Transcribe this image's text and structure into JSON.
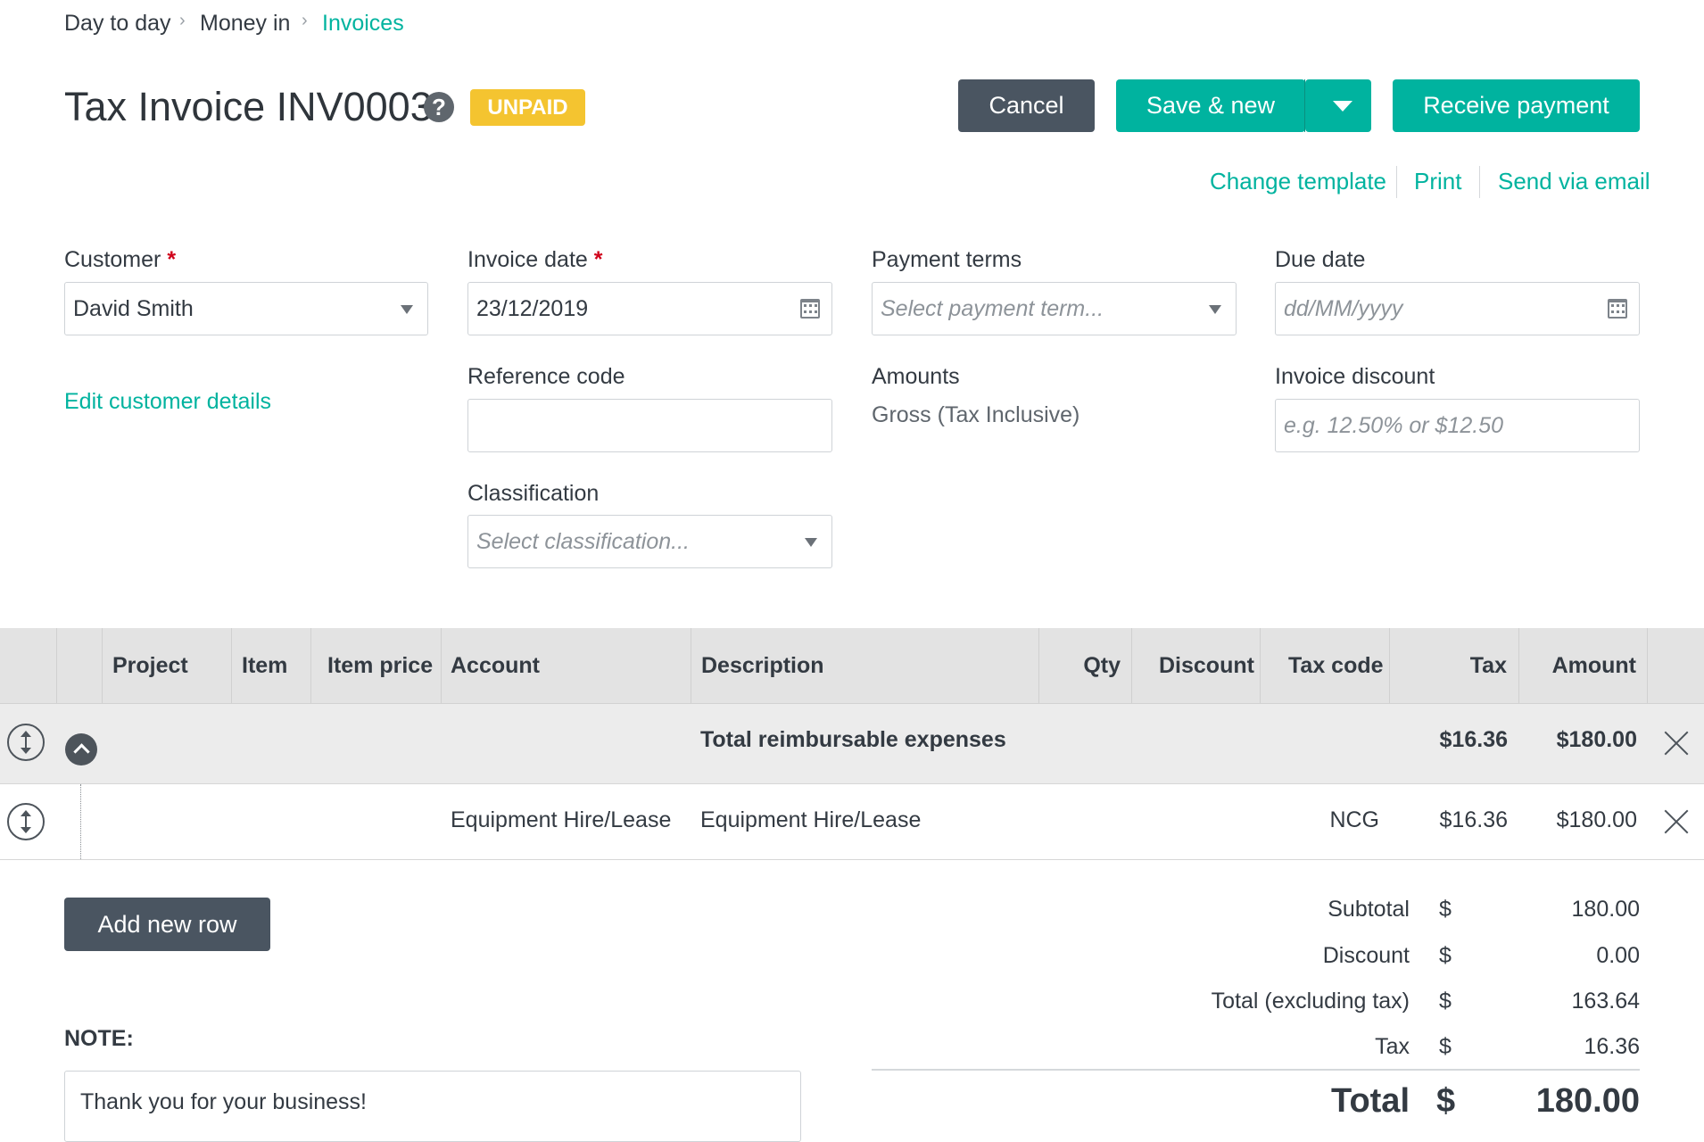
{
  "breadcrumb": {
    "items": [
      "Day to day",
      "Money in"
    ],
    "current": "Invoices"
  },
  "header": {
    "title": "Tax Invoice INV0003",
    "help_symbol": "?",
    "status": "UNPAID",
    "cancel": "Cancel",
    "save_new": "Save & new",
    "receive_payment": "Receive payment"
  },
  "links": {
    "change_template": "Change template",
    "print": "Print",
    "send_email": "Send via email"
  },
  "form": {
    "customer": {
      "label": "Customer",
      "required": "*",
      "value": "David Smith"
    },
    "invoice_date": {
      "label": "Invoice date",
      "required": "*",
      "value": "23/12/2019"
    },
    "payment_terms": {
      "label": "Payment terms",
      "placeholder": "Select payment term..."
    },
    "due_date": {
      "label": "Due date",
      "placeholder": "dd/MM/yyyy"
    },
    "edit_customer": "Edit customer details",
    "reference": {
      "label": "Reference code",
      "value": ""
    },
    "amounts": {
      "label": "Amounts",
      "value": "Gross (Tax Inclusive)"
    },
    "invoice_discount": {
      "label": "Invoice discount",
      "placeholder": "e.g. 12.50% or $12.50"
    },
    "classification": {
      "label": "Classification",
      "placeholder": "Select classification..."
    }
  },
  "table": {
    "columns": [
      "Project",
      "Item",
      "Item price",
      "Account",
      "Description",
      "Qty",
      "Discount",
      "Tax code",
      "Tax",
      "Amount"
    ],
    "group": {
      "label": "Total reimbursable expenses",
      "tax": "$16.36",
      "amount": "$180.00"
    },
    "rows": [
      {
        "account": "Equipment Hire/Lease",
        "description": "Equipment Hire/Lease",
        "tax_code": "NCG",
        "tax": "$16.36",
        "amount": "$180.00"
      }
    ]
  },
  "add_row": "Add new row",
  "note": {
    "label": "NOTE:",
    "value": "Thank you for your business!"
  },
  "summary": {
    "currency": "$",
    "subtotal_label": "Subtotal",
    "subtotal": "180.00",
    "discount_label": "Discount",
    "discount": "0.00",
    "excl_label": "Total (excluding tax)",
    "excl": "163.64",
    "tax_label": "Tax",
    "tax": "16.36",
    "total_label": "Total",
    "total": "180.00"
  },
  "colors": {
    "accent": "#00b39f",
    "dark_button": "#4a5561",
    "badge": "#f4c430",
    "required": "#d0021b"
  },
  "icons": [
    "help-icon",
    "chevron-right-icon",
    "chevron-down-icon",
    "dropdown-caret-icon",
    "calendar-icon",
    "drag-handle-icon",
    "collapse-icon",
    "close-icon"
  ]
}
